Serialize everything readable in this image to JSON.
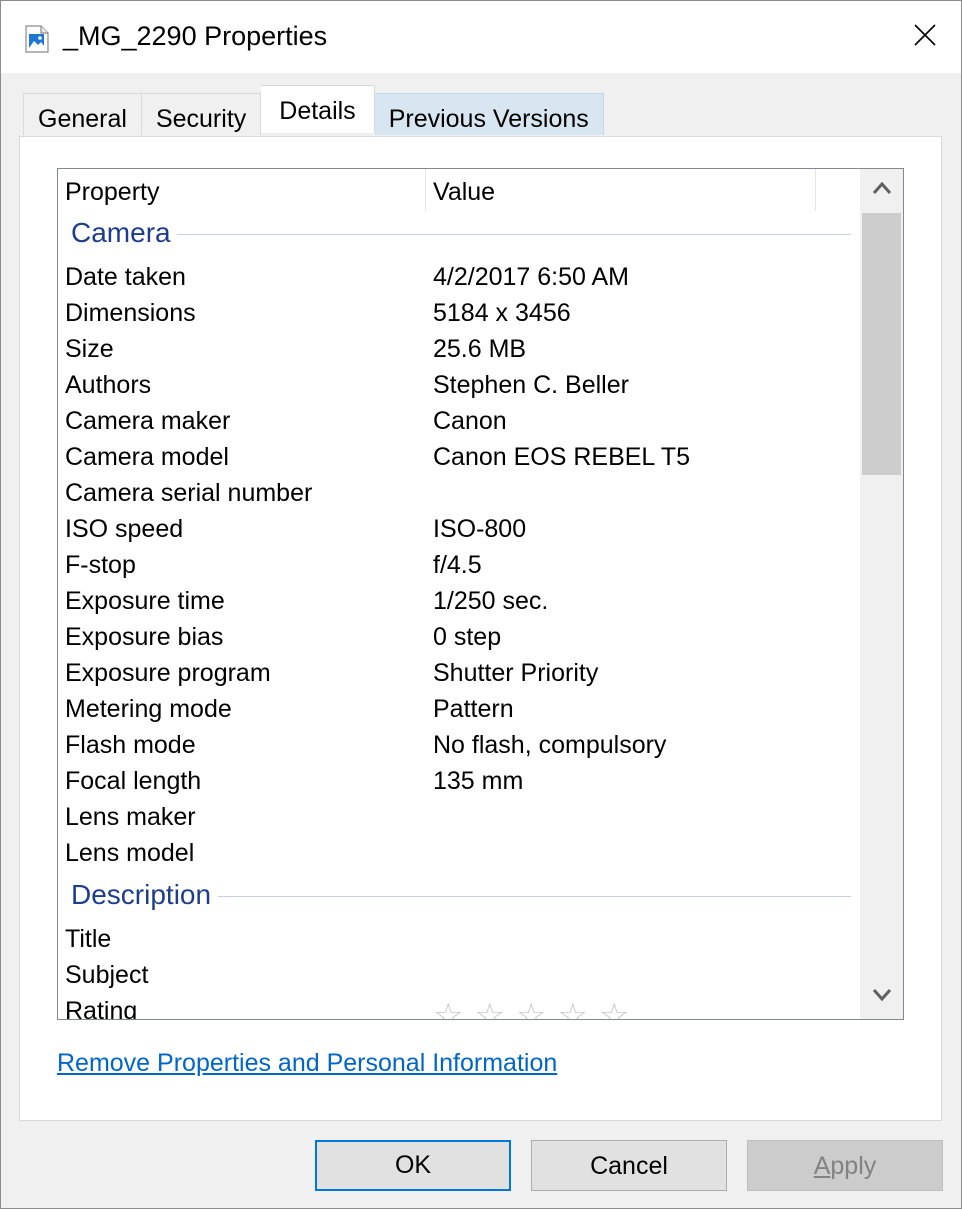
{
  "window": {
    "title": "_MG_2290 Properties"
  },
  "tabs": [
    {
      "label": "General"
    },
    {
      "label": "Security"
    },
    {
      "label": "Details"
    },
    {
      "label": "Previous Versions"
    }
  ],
  "list": {
    "header": {
      "property": "Property",
      "value": "Value"
    },
    "camera": {
      "group_title": "Camera",
      "rows": [
        {
          "property": "Date taken",
          "value": "4/2/2017 6:50 AM"
        },
        {
          "property": "Dimensions",
          "value": "5184 x 3456"
        },
        {
          "property": "Size",
          "value": "25.6 MB"
        },
        {
          "property": "Authors",
          "value": "Stephen C. Beller"
        },
        {
          "property": "Camera maker",
          "value": "Canon"
        },
        {
          "property": "Camera model",
          "value": "Canon EOS REBEL T5"
        },
        {
          "property": "Camera serial number",
          "value": ""
        },
        {
          "property": "ISO speed",
          "value": "ISO-800"
        },
        {
          "property": "F-stop",
          "value": "f/4.5"
        },
        {
          "property": "Exposure time",
          "value": "1/250 sec."
        },
        {
          "property": "Exposure bias",
          "value": "0 step"
        },
        {
          "property": "Exposure program",
          "value": "Shutter Priority"
        },
        {
          "property": "Metering mode",
          "value": "Pattern"
        },
        {
          "property": "Flash mode",
          "value": "No flash, compulsory"
        },
        {
          "property": "Focal length",
          "value": "135 mm"
        },
        {
          "property": "Lens maker",
          "value": ""
        },
        {
          "property": "Lens model",
          "value": ""
        }
      ]
    },
    "description": {
      "group_title": "Description",
      "rows": [
        {
          "property": "Title",
          "value": ""
        },
        {
          "property": "Subject",
          "value": ""
        },
        {
          "property": "Rating",
          "value": ""
        }
      ],
      "rating_stars_filled": 0,
      "rating_stars_total": 5
    }
  },
  "link": {
    "remove_properties": "Remove Properties and Personal Information"
  },
  "buttons": {
    "ok": "OK",
    "cancel": "Cancel",
    "apply_underlined": "A",
    "apply_rest": "pply"
  },
  "colors": {
    "group_title": "#1e3d8f",
    "link": "#0066cc",
    "focus_border": "#0078d7"
  }
}
